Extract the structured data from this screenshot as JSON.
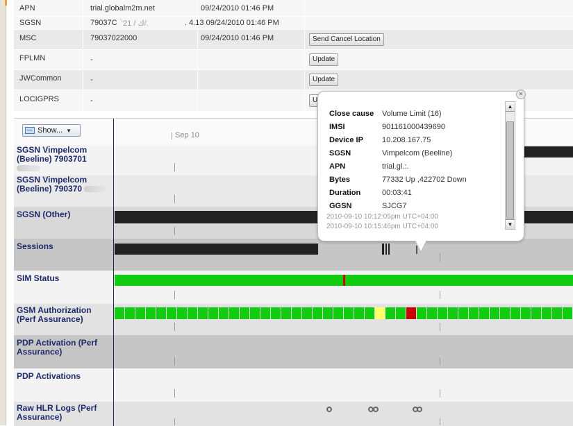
{
  "attributes": [
    {
      "name": "APN",
      "value": "trial.globalm2m.net",
      "updated": "09/24/2010 01:46 PM",
      "action": ""
    },
    {
      "name": "SGSN",
      "value": "79037C",
      "value_extra": "’́ك / 21/.",
      "value_tail": ". 4.13",
      "updated": "09/24/2010 01:46 PM",
      "action": ""
    },
    {
      "name": "MSC",
      "value": "79037022000",
      "updated": "09/24/2010 01:46 PM",
      "action": "Send Cancel Location"
    },
    {
      "name": "FPLMN",
      "value": "-",
      "updated": "",
      "action": "Update"
    },
    {
      "name": "JWCommon",
      "value": "-",
      "updated": "",
      "action": "Update"
    },
    {
      "name": "LOCIGPRS",
      "value": "-",
      "updated": "",
      "action": "U"
    }
  ],
  "timeline": {
    "show_button": "Show...",
    "axis_label": "Sep 10",
    "rows": [
      {
        "label": "SGSN Vimpelcom (Beeline) 7903701"
      },
      {
        "label": "SGSN Vimpelcom (Beeline) 790370"
      },
      {
        "label": "SGSN (Other)"
      },
      {
        "label": "Sessions"
      },
      {
        "label": "SIM Status"
      },
      {
        "label": "GSM Authorization (Perf Assurance)"
      },
      {
        "label": "PDP Activation (Perf Assurance)"
      },
      {
        "label": "PDP Activations"
      },
      {
        "label": "Raw HLR Logs (Perf Assurance)"
      }
    ]
  },
  "popup": {
    "fields": [
      {
        "key": "Close cause",
        "value": "Volume Limit (16)"
      },
      {
        "key": "IMSI",
        "value": "901161000439690"
      },
      {
        "key": "Device IP",
        "value": "10.208.167.75"
      },
      {
        "key": "SGSN",
        "value": "Vimpelcom (Beeline)"
      },
      {
        "key": "APN",
        "value": "trial.gl.:."
      },
      {
        "key": "Bytes",
        "value": "77332 Up ,422702 Down"
      },
      {
        "key": "Duration",
        "value": "00:03:41"
      },
      {
        "key": "GGSN",
        "value": "SJCG7"
      }
    ],
    "start_time": "2010-09-10 10:12:05pm UTC+04:00",
    "end_time": "2010-09-10 10:15:46pm UTC+04:00"
  },
  "colors": {
    "label_text": "#1e2a6a",
    "bar_dark": "#222222",
    "status_green": "#11cc11",
    "status_red": "#cc0000",
    "status_yellow": "#ffff66"
  },
  "icons": {
    "show_icon": "list-icon",
    "dropdown": "chevron-down-icon",
    "close": "close-icon",
    "scroll_up": "arrow-up-icon",
    "scroll_down": "arrow-down-icon"
  }
}
